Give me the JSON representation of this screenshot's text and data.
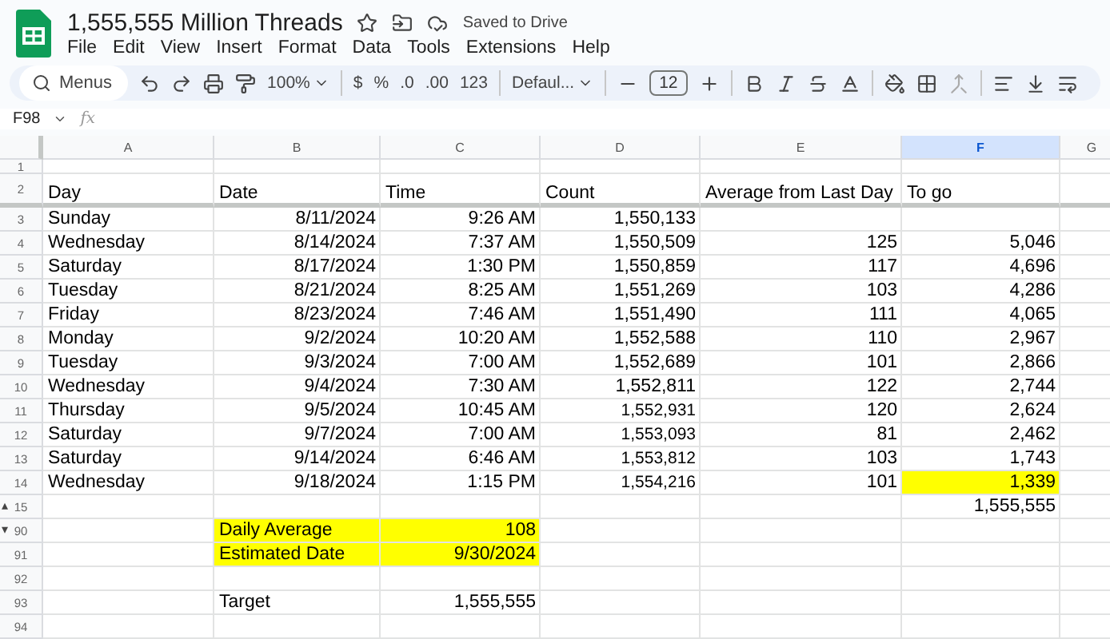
{
  "document": {
    "title": "1,555,555 Million Threads",
    "save_status": "Saved to Drive"
  },
  "menu": [
    "File",
    "Edit",
    "View",
    "Insert",
    "Format",
    "Data",
    "Tools",
    "Extensions",
    "Help"
  ],
  "toolbar": {
    "search_label": "Menus",
    "zoom": "100%",
    "currency": "$",
    "percent": "%",
    "decrease_decimals": ".0",
    "increase_decimals": ".00",
    "number_format": "123",
    "font": "Defaul...",
    "font_size": "12"
  },
  "formula_bar": {
    "cell_ref": "F98",
    "function_label": "fx"
  },
  "columns": [
    {
      "label": "A",
      "selected": false
    },
    {
      "label": "B",
      "selected": false
    },
    {
      "label": "C",
      "selected": false
    },
    {
      "label": "D",
      "selected": false
    },
    {
      "label": "E",
      "selected": false
    },
    {
      "label": "F",
      "selected": true
    },
    {
      "label": "G",
      "selected": false
    }
  ],
  "rows": [
    {
      "header": "1",
      "cells": []
    },
    {
      "header": "2",
      "frozen_edge": true,
      "cells": [
        {
          "text": "Day",
          "highlighted": false
        },
        {
          "text": "Date",
          "highlighted": false
        },
        {
          "text": "Time",
          "highlighted": false
        },
        {
          "text": "Count",
          "highlighted": false
        },
        {
          "text": "Average from Last Day",
          "highlighted": false
        },
        {
          "text": "To go",
          "highlighted": false
        }
      ]
    },
    {
      "header": "3",
      "frozen_edge": false,
      "cells": [
        {
          "text": "Sunday",
          "highlighted": false
        },
        {
          "text": "8/11/2024",
          "kind": "number",
          "highlighted": false
        },
        {
          "text": "9:26 AM",
          "kind": "number",
          "highlighted": false
        },
        {
          "text": "1,550,133",
          "kind": "number",
          "highlighted": false
        }
      ]
    },
    {
      "header": "4",
      "frozen_edge": false,
      "cells": [
        {
          "text": "Wednesday",
          "highlighted": false
        },
        {
          "text": "8/14/2024",
          "kind": "number",
          "highlighted": false
        },
        {
          "text": "7:37 AM",
          "kind": "number",
          "highlighted": false
        },
        {
          "text": "1,550,509",
          "kind": "number",
          "highlighted": false
        },
        {
          "text": "125",
          "kind": "number",
          "highlighted": false
        },
        {
          "text": "5,046",
          "kind": "number",
          "highlighted": false
        }
      ]
    },
    {
      "header": "5",
      "frozen_edge": false,
      "cells": [
        {
          "text": "Saturday",
          "highlighted": false
        },
        {
          "text": "8/17/2024",
          "kind": "number",
          "highlighted": false
        },
        {
          "text": "1:30 PM",
          "kind": "number",
          "highlighted": false
        },
        {
          "text": "1,550,859",
          "kind": "number",
          "highlighted": false
        },
        {
          "text": "117",
          "kind": "number",
          "highlighted": false
        },
        {
          "text": "4,696",
          "kind": "number",
          "highlighted": false
        }
      ]
    },
    {
      "header": "6",
      "frozen_edge": false,
      "cells": [
        {
          "text": "Tuesday",
          "highlighted": false
        },
        {
          "text": "8/21/2024",
          "kind": "number",
          "highlighted": false
        },
        {
          "text": "8:25 AM",
          "kind": "number",
          "highlighted": false
        },
        {
          "text": "1,551,269",
          "kind": "number",
          "highlighted": false
        },
        {
          "text": "103",
          "kind": "number",
          "highlighted": false
        },
        {
          "text": "4,286",
          "kind": "number",
          "highlighted": false
        }
      ]
    },
    {
      "header": "7",
      "frozen_edge": false,
      "cells": [
        {
          "text": "Friday",
          "highlighted": false
        },
        {
          "text": "8/23/2024",
          "kind": "number",
          "highlighted": false
        },
        {
          "text": "7:46 AM",
          "kind": "number",
          "highlighted": false
        },
        {
          "text": "1,551,490",
          "kind": "number",
          "highlighted": false
        },
        {
          "text": "111",
          "kind": "number",
          "highlighted": false
        },
        {
          "text": "4,065",
          "kind": "number",
          "highlighted": false
        }
      ]
    },
    {
      "header": "8",
      "frozen_edge": false,
      "cells": [
        {
          "text": "Monday",
          "highlighted": false
        },
        {
          "text": "9/2/2024",
          "kind": "number",
          "highlighted": false
        },
        {
          "text": "10:20 AM",
          "kind": "number",
          "highlighted": false
        },
        {
          "text": "1,552,588",
          "kind": "number",
          "highlighted": false
        },
        {
          "text": "110",
          "kind": "number",
          "highlighted": false
        },
        {
          "text": "2,967",
          "kind": "number",
          "highlighted": false
        }
      ]
    },
    {
      "header": "9",
      "frozen_edge": false,
      "cells": [
        {
          "text": "Tuesday",
          "highlighted": false
        },
        {
          "text": "9/3/2024",
          "kind": "number",
          "highlighted": false
        },
        {
          "text": "7:00 AM",
          "kind": "number",
          "highlighted": false
        },
        {
          "text": "1,552,689",
          "kind": "number",
          "highlighted": false
        },
        {
          "text": "101",
          "kind": "number",
          "highlighted": false
        },
        {
          "text": "2,866",
          "kind": "number",
          "highlighted": false
        }
      ]
    },
    {
      "header": "10",
      "frozen_edge": false,
      "cells": [
        {
          "text": "Wednesday",
          "highlighted": false
        },
        {
          "text": "9/4/2024",
          "kind": "number",
          "highlighted": false
        },
        {
          "text": "7:30 AM",
          "kind": "number",
          "highlighted": false
        },
        {
          "text": "1,552,811",
          "kind": "number",
          "highlighted": false
        },
        {
          "text": "122",
          "kind": "number",
          "highlighted": false
        },
        {
          "text": "2,744",
          "kind": "number",
          "highlighted": false
        }
      ]
    },
    {
      "header": "11",
      "frozen_edge": false,
      "cells": [
        {
          "text": "Thursday",
          "highlighted": false
        },
        {
          "text": "9/5/2024",
          "kind": "number",
          "highlighted": false
        },
        {
          "text": "10:45 AM",
          "kind": "number",
          "highlighted": false
        },
        {
          "text": "1,552,931",
          "kind": "small",
          "highlighted": false
        },
        {
          "text": "120",
          "kind": "number",
          "highlighted": false
        },
        {
          "text": "2,624",
          "kind": "number",
          "highlighted": false
        }
      ]
    },
    {
      "header": "12",
      "frozen_edge": false,
      "cells": [
        {
          "text": "Saturday",
          "highlighted": false
        },
        {
          "text": "9/7/2024",
          "kind": "number",
          "highlighted": false
        },
        {
          "text": "7:00 AM",
          "kind": "number",
          "highlighted": false
        },
        {
          "text": "1,553,093",
          "kind": "small",
          "highlighted": false
        },
        {
          "text": "81",
          "kind": "number",
          "highlighted": false
        },
        {
          "text": "2,462",
          "kind": "number",
          "highlighted": false
        }
      ]
    },
    {
      "header": "13",
      "frozen_edge": false,
      "cells": [
        {
          "text": "Saturday",
          "highlighted": false
        },
        {
          "text": "9/14/2024",
          "kind": "number",
          "highlighted": false
        },
        {
          "text": "6:46 AM",
          "kind": "number",
          "highlighted": false
        },
        {
          "text": "1,553,812",
          "kind": "small",
          "highlighted": false
        },
        {
          "text": "103",
          "kind": "number",
          "highlighted": false
        },
        {
          "text": "1,743",
          "kind": "number",
          "highlighted": false
        }
      ]
    },
    {
      "header": "14",
      "frozen_edge": false,
      "cells": [
        {
          "text": "Wednesday",
          "highlighted": false
        },
        {
          "text": "9/18/2024",
          "kind": "number",
          "highlighted": false
        },
        {
          "text": "1:15 PM",
          "kind": "number",
          "highlighted": false
        },
        {
          "text": "1,554,216",
          "kind": "small",
          "highlighted": false
        },
        {
          "text": "101",
          "kind": "number",
          "highlighted": false
        },
        {
          "text": "1,339",
          "kind": "number",
          "highlighted": true
        }
      ]
    },
    {
      "header": "15",
      "fold": "▴",
      "frozen_edge": false,
      "cells": [
        {},
        {},
        {},
        {},
        {},
        {
          "text": "1,555,555",
          "kind": "number",
          "highlighted": false
        }
      ]
    },
    {
      "header": "90",
      "fold": "▾",
      "frozen_edge": false,
      "cells": [
        {},
        {
          "text": "Daily Average",
          "highlighted": true
        },
        {
          "text": "108",
          "kind": "number",
          "highlighted": true
        }
      ]
    },
    {
      "header": "91",
      "frozen_edge": false,
      "cells": [
        {},
        {
          "text": "Estimated Date",
          "highlighted": true
        },
        {
          "text": "9/30/2024",
          "kind": "number",
          "highlighted": true
        }
      ]
    },
    {
      "header": "92",
      "cells": []
    },
    {
      "header": "93",
      "frozen_edge": false,
      "cells": [
        {},
        {
          "text": "Target",
          "highlighted": false
        },
        {
          "text": "1,555,555",
          "kind": "number",
          "highlighted": false
        }
      ]
    },
    {
      "header": "94",
      "cells": []
    }
  ]
}
